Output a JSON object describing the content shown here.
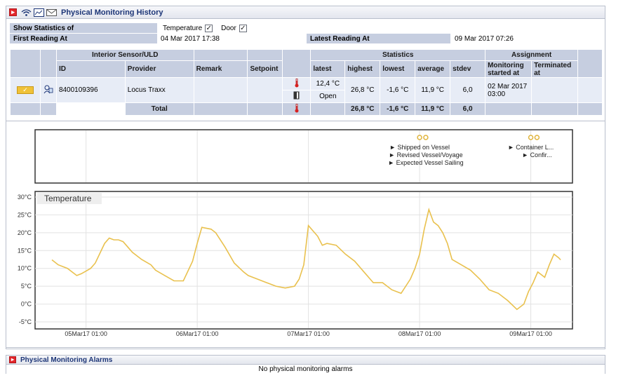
{
  "history": {
    "title": "Physical Monitoring History",
    "icons": [
      "wifi-signal-icon",
      "chart-image-icon",
      "envelope-icon"
    ],
    "show_stats_label": "Show Statistics of",
    "temperature_label": "Temperature",
    "temperature_checked": true,
    "door_label": "Door",
    "door_checked": true,
    "first_reading_label": "First Reading At",
    "first_reading_value": "04 Mar 2017 17:38",
    "latest_reading_label": "Latest Reading At",
    "latest_reading_value": "09 Mar 2017 07:26"
  },
  "table": {
    "group_sensor": "Interior Sensor/ULD",
    "group_statistics": "Statistics",
    "group_assignment": "Assignment",
    "col_id": "ID",
    "col_provider": "Provider",
    "col_remark": "Remark",
    "col_setpoint": "Setpoint",
    "col_latest": "latest",
    "col_highest": "highest",
    "col_lowest": "lowest",
    "col_average": "average",
    "col_stdev": "stdev",
    "col_monitoring_started": "Monitoring started at",
    "col_terminated": "Terminated at",
    "row": {
      "id": "8400109396",
      "provider": "Locus Traxx",
      "remark": "",
      "setpoint": "",
      "latest_temp": "12,4 °C",
      "highest": "26,8 °C",
      "lowest": "-1,6 °C",
      "average": "11,9 °C",
      "stdev": "6,0",
      "latest_door": "Open",
      "monitoring_started": "02 Mar 2017 03:00",
      "terminated": ""
    },
    "total": {
      "label": "Total",
      "highest": "26,8 °C",
      "lowest": "-1,6 °C",
      "average": "11,9 °C",
      "stdev": "6,0"
    }
  },
  "events": [
    {
      "label": "Shipped on Vessel",
      "date": "2017-03-08T01:00"
    },
    {
      "label": "Revised Vessel/Voyage",
      "date": "2017-03-08T02:20"
    },
    {
      "label": "Expected Vessel Sailing",
      "date": "2017-03-08T02:20"
    },
    {
      "label": "Container L...",
      "date": "2017-03-09T01:00"
    },
    {
      "label": "Confir...",
      "date": "2017-03-09T02:20"
    }
  ],
  "chart_data": {
    "type": "line",
    "title": "Temperature",
    "ylabel": "",
    "xlabel": "",
    "ylim": [
      -5,
      30
    ],
    "yticks": [
      30,
      25,
      20,
      15,
      10,
      5,
      0,
      -5
    ],
    "ytick_labels": [
      "30°C",
      "25°C",
      "20°C",
      "15°C",
      "10°C",
      "5°C",
      "0°C",
      "-5°C"
    ],
    "xticks": [
      "2017-03-05T01:00",
      "2017-03-06T01:00",
      "2017-03-07T01:00",
      "2017-03-08T01:00",
      "2017-03-09T01:00"
    ],
    "xtick_labels": [
      "05Mar17 01:00",
      "06Mar17 01:00",
      "07Mar17 01:00",
      "08Mar17 01:00",
      "09Mar17 01:00"
    ],
    "xlim": [
      "2017-03-04T14:00",
      "2017-03-09T10:00"
    ],
    "grid": true,
    "color": "#e9c14e",
    "series": [
      {
        "x": [
          "2017-03-04T17:38",
          "2017-03-04T19:00",
          "2017-03-04T21:00",
          "2017-03-04T23:00",
          "2017-03-05T00:00",
          "2017-03-05T02:00",
          "2017-03-05T03:00",
          "2017-03-05T05:00",
          "2017-03-05T06:00",
          "2017-03-05T07:00",
          "2017-03-05T08:00",
          "2017-03-05T09:00",
          "2017-03-05T10:00",
          "2017-03-05T11:00",
          "2017-03-05T12:00",
          "2017-03-05T13:00",
          "2017-03-05T15:00",
          "2017-03-05T16:00",
          "2017-03-05T18:00",
          "2017-03-05T20:00",
          "2017-03-05T22:00",
          "2017-03-06T00:00",
          "2017-03-06T01:00",
          "2017-03-06T02:00",
          "2017-03-06T04:00",
          "2017-03-06T05:00",
          "2017-03-06T07:00",
          "2017-03-06T09:00",
          "2017-03-06T11:00",
          "2017-03-06T12:00",
          "2017-03-06T14:00",
          "2017-03-06T16:00",
          "2017-03-06T18:00",
          "2017-03-06T20:00",
          "2017-03-06T22:00",
          "2017-03-06T23:00",
          "2017-03-07T00:00",
          "2017-03-07T01:00",
          "2017-03-07T03:00",
          "2017-03-07T04:00",
          "2017-03-07T05:00",
          "2017-03-07T07:00",
          "2017-03-07T09:00",
          "2017-03-07T11:00",
          "2017-03-07T13:00",
          "2017-03-07T15:00",
          "2017-03-07T17:00",
          "2017-03-07T19:00",
          "2017-03-07T21:00",
          "2017-03-07T23:00",
          "2017-03-08T00:00",
          "2017-03-08T01:00",
          "2017-03-08T02:00",
          "2017-03-08T03:00",
          "2017-03-08T04:00",
          "2017-03-08T05:00",
          "2017-03-08T06:00",
          "2017-03-08T07:00",
          "2017-03-08T08:00",
          "2017-03-08T10:00",
          "2017-03-08T12:00",
          "2017-03-08T14:00",
          "2017-03-08T16:00",
          "2017-03-08T18:00",
          "2017-03-08T20:00",
          "2017-03-08T22:00",
          "2017-03-08T23:30",
          "2017-03-09T00:30",
          "2017-03-09T01:30",
          "2017-03-09T02:30",
          "2017-03-09T04:00",
          "2017-03-09T05:00",
          "2017-03-09T06:00",
          "2017-03-09T07:00",
          "2017-03-09T07:26"
        ],
        "y": [
          12.4,
          11,
          10,
          8,
          8.5,
          10,
          11.5,
          17,
          18.5,
          18,
          18,
          17.5,
          16,
          14.5,
          13.5,
          12.5,
          11,
          9.5,
          8,
          6.5,
          6.5,
          12,
          17,
          21.5,
          21,
          20,
          16,
          11.5,
          9,
          8,
          7,
          6,
          5,
          4.5,
          5,
          7,
          11,
          22,
          19,
          16.5,
          17,
          16.5,
          14,
          12,
          9,
          6,
          6,
          4,
          3,
          7,
          10,
          14,
          21,
          26.5,
          23,
          22,
          20,
          17,
          12.5,
          11,
          9.5,
          7,
          4,
          3,
          1,
          -1.5,
          0,
          3.5,
          6,
          9,
          7.5,
          11,
          14,
          13,
          12.4
        ]
      }
    ]
  },
  "alarms": {
    "title": "Physical Monitoring Alarms",
    "empty_text": "No physical monitoring alarms"
  }
}
